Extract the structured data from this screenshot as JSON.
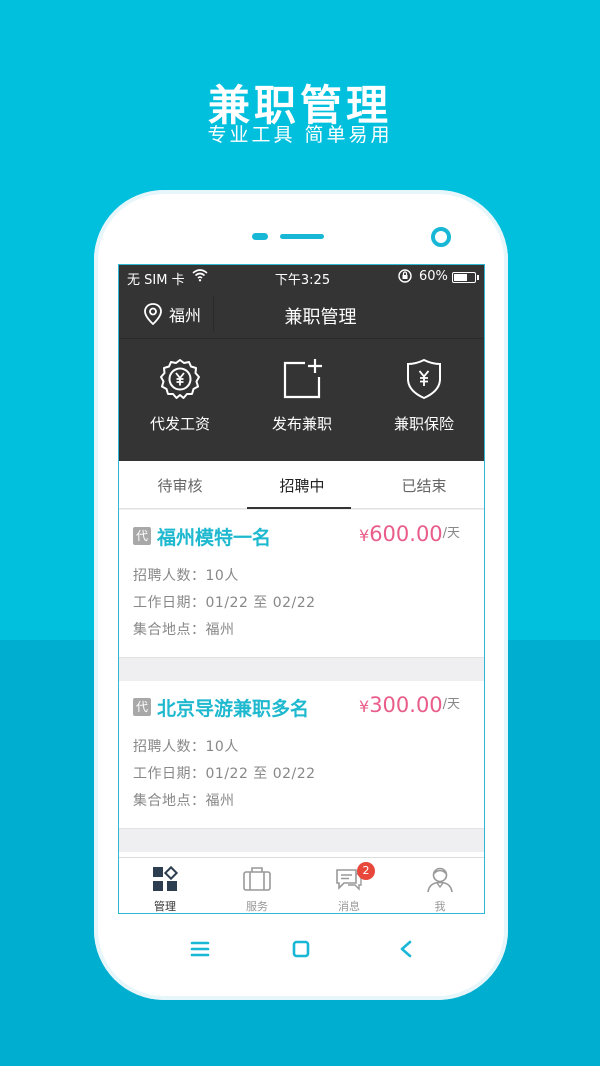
{
  "promo": {
    "title": "兼职管理",
    "subtitle": "专业工具 简单易用"
  },
  "status_bar": {
    "carrier": "无 SIM 卡",
    "time": "下午3:25",
    "battery": "60%"
  },
  "header": {
    "location": "福州",
    "title": "兼职管理"
  },
  "quick_actions": [
    {
      "label": "代发工资",
      "icon": "yen-seal-icon"
    },
    {
      "label": "发布兼职",
      "icon": "add-post-icon"
    },
    {
      "label": "兼职保险",
      "icon": "yen-shield-icon"
    }
  ],
  "tabs": [
    {
      "label": "待审核"
    },
    {
      "label": "招聘中"
    },
    {
      "label": "已结束"
    }
  ],
  "active_tab": "招聘中",
  "jobs": [
    {
      "tag": "代",
      "name": "福州模特一名",
      "yen": "¥",
      "price": "600.00",
      "unit": "/天",
      "count_line": "招聘人数：10人",
      "date_line": "工作日期：01/22 至 02/22",
      "place_line": "集合地点：福州"
    },
    {
      "tag": "代",
      "name": "北京导游兼职多名",
      "yen": "¥",
      "price": "300.00",
      "unit": "/天",
      "count_line": "招聘人数：10人",
      "date_line": "工作日期：01/22 至 02/22",
      "place_line": "集合地点：福州"
    }
  ],
  "tabbar": [
    {
      "label": "管理",
      "icon": "grid-icon"
    },
    {
      "label": "服务",
      "icon": "briefcase-icon"
    },
    {
      "label": "消息",
      "icon": "chat-icon",
      "badge": "2"
    },
    {
      "label": "我",
      "icon": "user-icon"
    }
  ],
  "colors": {
    "background": "#00c0de",
    "accent": "#1eb8cf",
    "price": "#e85d8a",
    "dark_header": "#343434"
  }
}
